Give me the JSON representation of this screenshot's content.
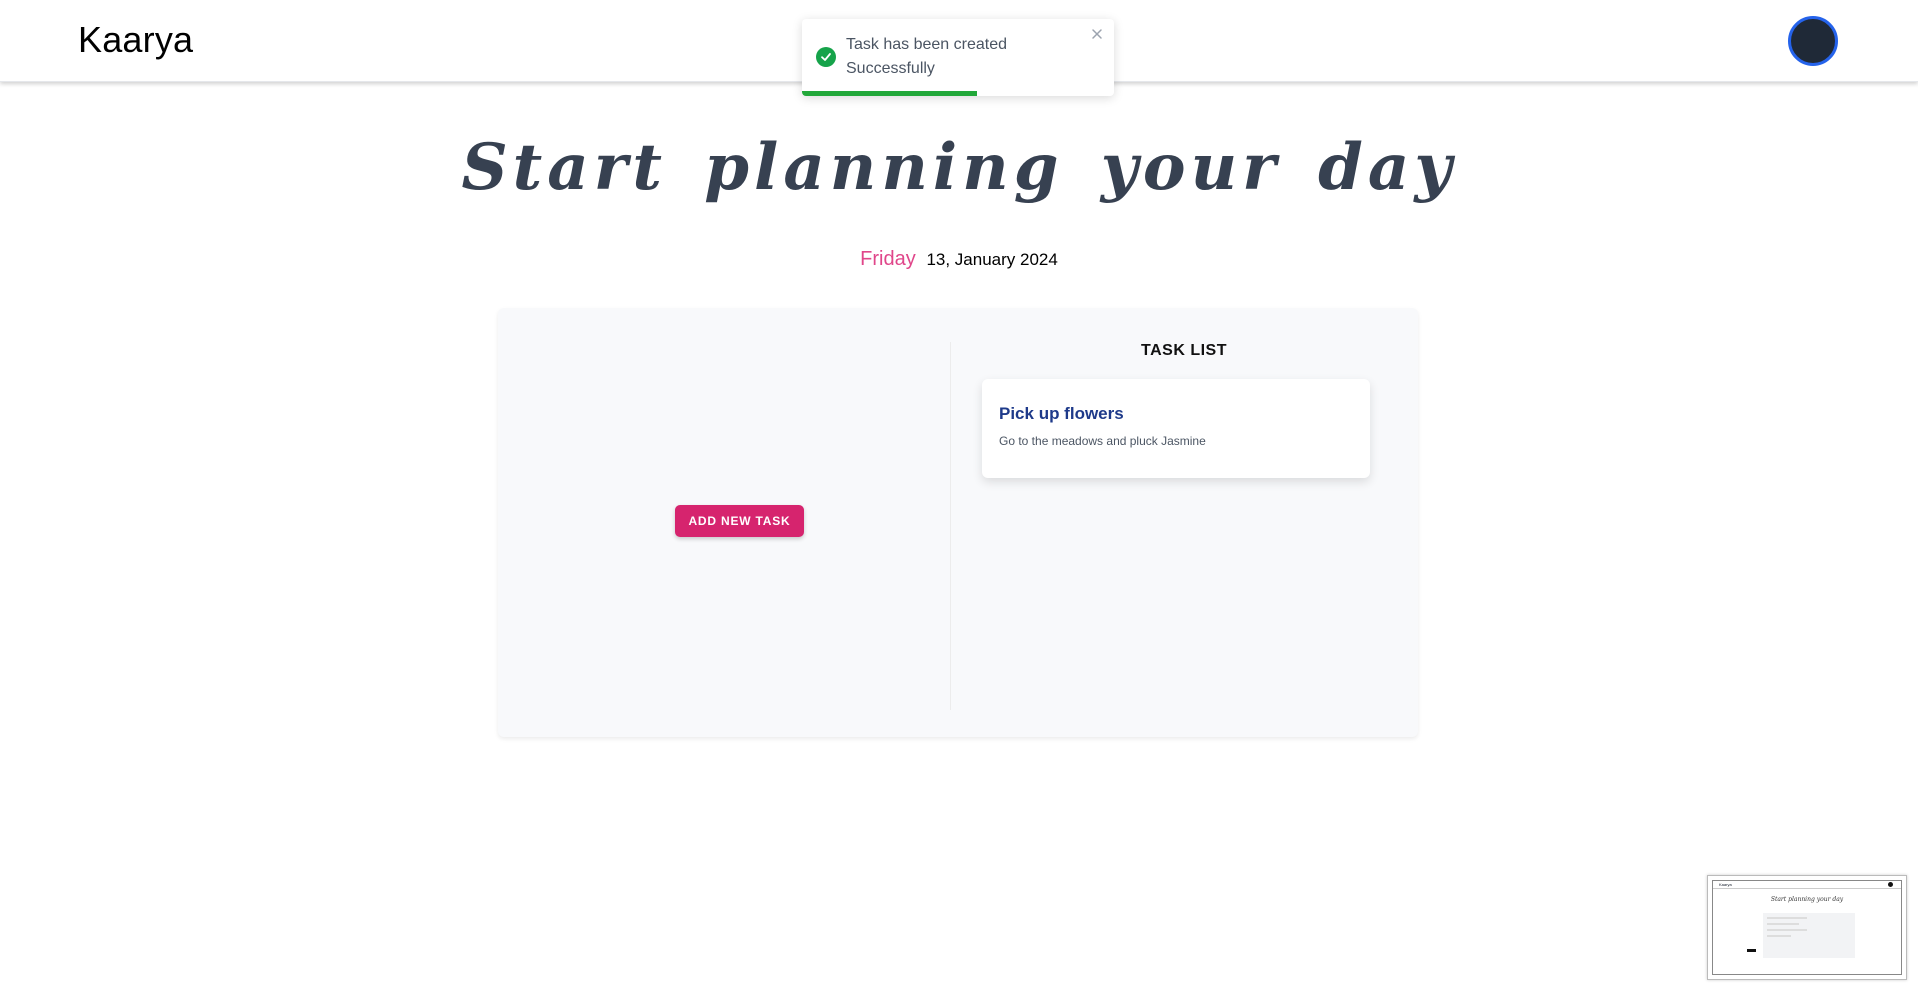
{
  "navbar": {
    "brand": "Kaarya"
  },
  "toast": {
    "message": "Task has been created Successfully",
    "progress": 0.56
  },
  "hero": {
    "title": "Start planning your day"
  },
  "date": {
    "day": "Friday",
    "date": "13, January 2024"
  },
  "panel": {
    "add_button_label": "ADD NEW TASK",
    "task_list_title": "TASK LIST",
    "tasks": [
      {
        "title": "Pick up flowers",
        "description": "Go to the meadows and pluck Jasmine"
      }
    ]
  },
  "minimap": {
    "brand": "Kaarya",
    "hero": "Start planning your day"
  },
  "colors": {
    "accent_pink": "#d6246e",
    "day_pink": "#e0468a",
    "success_green": "#22a83a",
    "task_title_blue": "#1e3a8a"
  }
}
